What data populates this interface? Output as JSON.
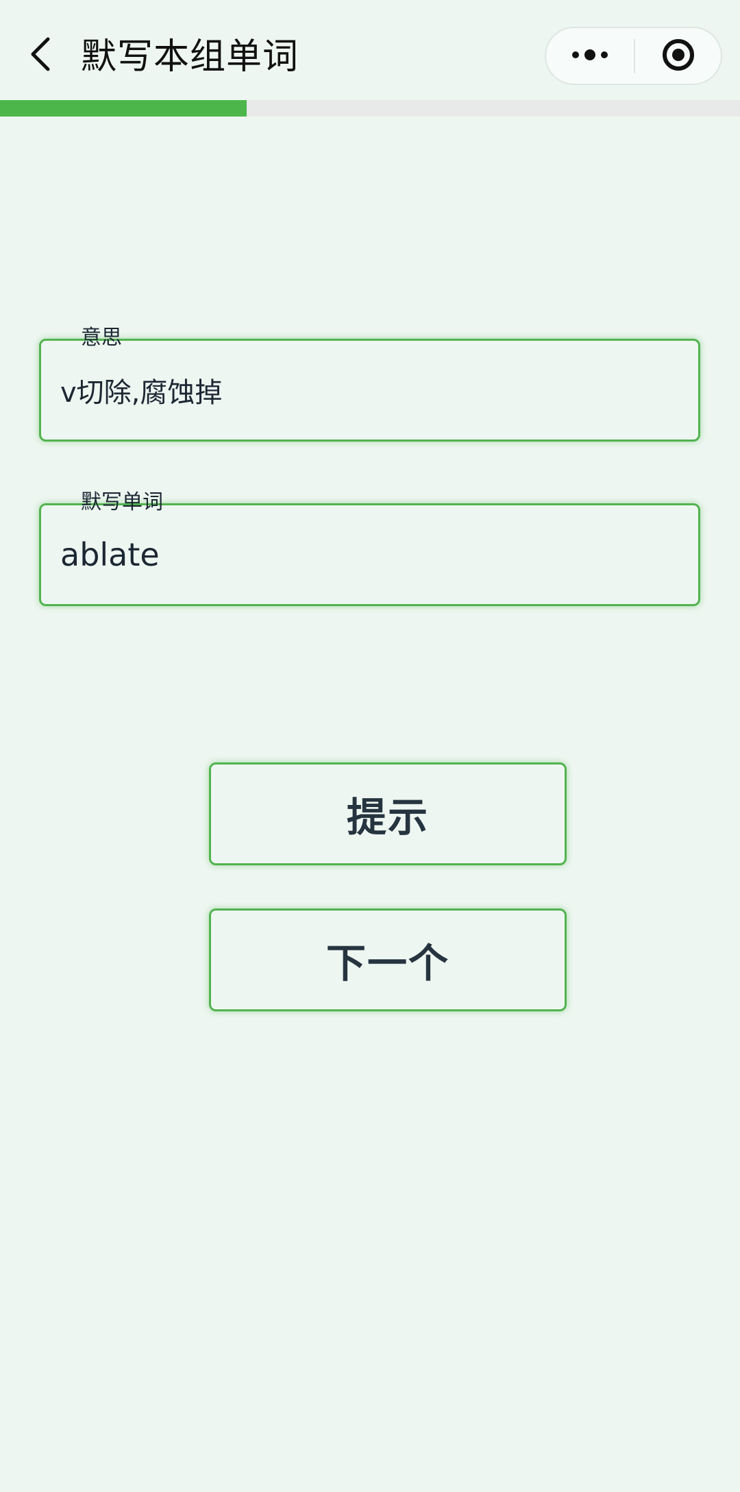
{
  "header": {
    "title": "默写本组单词",
    "back_icon": "chevron-left-icon",
    "more_icon": "more-dots-icon",
    "close_icon": "target-close-icon"
  },
  "progress": {
    "fraction": 0.333,
    "fill_color": "#4cb64a",
    "track_color": "#e8e9e9"
  },
  "meaning_field": {
    "label": "意思",
    "value": "v切除,腐蚀掉"
  },
  "word_field": {
    "label": "默写单词",
    "value": "ablate"
  },
  "buttons": {
    "hint_label": "提示",
    "next_label": "下一个"
  },
  "colors": {
    "accent": "#52b34f",
    "background": "#eef6f1",
    "text": "#1c2733"
  }
}
